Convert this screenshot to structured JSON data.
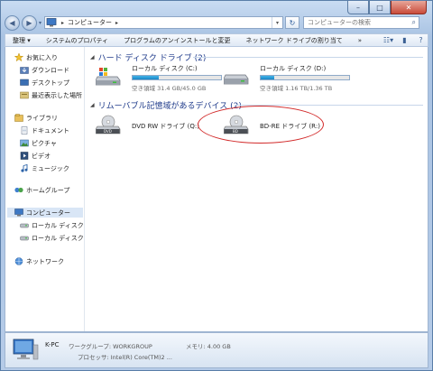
{
  "window": {
    "minimize": "–",
    "maximize": "□",
    "close": "✕"
  },
  "address": {
    "crumbs": [
      "コンピューター"
    ],
    "search_placeholder": "コンピューターの検索"
  },
  "toolbar": {
    "items": [
      "整理 ▾",
      "システムのプロパティ",
      "プログラムのアンインストールと変更",
      "ネットワーク ドライブの割り当て",
      "»"
    ]
  },
  "nav": {
    "favorites": "お気に入り",
    "downloads": "ダウンロード",
    "desktop": "デスクトップ",
    "recent": "最近表示した場所",
    "libraries": "ライブラリ",
    "documents": "ドキュメント",
    "pictures": "ピクチャ",
    "videos": "ビデオ",
    "music": "ミュージック",
    "homegroup": "ホームグループ",
    "computer": "コンピューター",
    "local_c": "ローカル ディスク (",
    "local_d": "ローカル ディスク (",
    "network": "ネットワーク"
  },
  "groups": {
    "hdd": "ハード ディスク ドライブ (2)",
    "removable": "リムーバブル記憶域があるデバイス (2)"
  },
  "drives": [
    {
      "name": "ローカル ディスク (C:)",
      "free": "空き領域 31.4 GB/45.0 GB",
      "used_fraction": 0.3
    },
    {
      "name": "ローカル ディスク (D:)",
      "free": "空き領域 1.16 TB/1.36 TB",
      "used_fraction": 0.15
    }
  ],
  "removable": [
    {
      "name": "DVD RW ドライブ (Q:)",
      "label": "DVD"
    },
    {
      "name": "BD-RE ドライブ (R:)",
      "label": "BD"
    }
  ],
  "details": {
    "pc_name": "K-PC",
    "workgroup": "ワークグループ: WORKGROUP",
    "memory": "メモリ: 4.00 GB",
    "cpu": "プロセッサ: Intel(R) Core(TM)2 ..."
  },
  "colors": {
    "accent": "#1e3a8a",
    "bar_fill": "#1b86c6",
    "highlight_ellipse": "#d22a2a"
  }
}
